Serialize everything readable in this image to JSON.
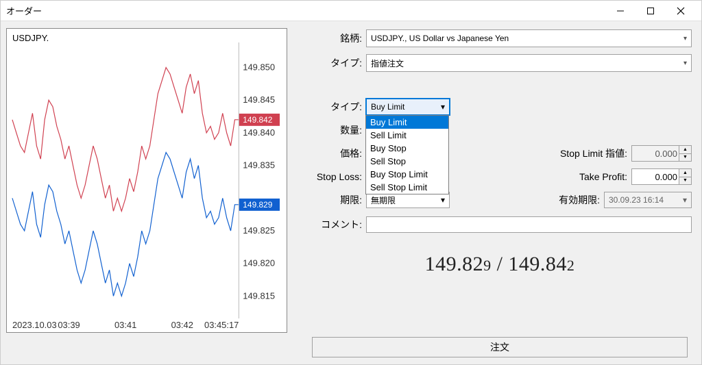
{
  "window": {
    "title": "オーダー"
  },
  "chart": {
    "symbol": "USDJPY.",
    "bid": "149.829",
    "ask": "149.842",
    "x_ticks": [
      "2023.10.03",
      "03:39",
      "03:41",
      "03:42",
      "03:45:17"
    ],
    "y_ticks": [
      "149.850",
      "149.845",
      "149.840",
      "149.835",
      "149.825",
      "149.820",
      "149.815"
    ]
  },
  "form": {
    "labels": {
      "symbol": "銘柄:",
      "type": "タイプ:",
      "order_type": "タイプ:",
      "volume": "数量:",
      "price": "価格:",
      "sl": "Stop Loss:",
      "expiry": "期限:",
      "comment": "コメント:",
      "stop_limit_price": "Stop Limit 指値:",
      "tp": "Take Profit:",
      "expiry_date": "有効期限:"
    },
    "symbol_value": "USDJPY., US Dollar vs Japanese Yen",
    "type_value": "指値注文",
    "order_type_value": "Buy Limit",
    "order_type_options": [
      "Buy Limit",
      "Sell Limit",
      "Buy Stop",
      "Sell Stop",
      "Buy Stop Limit",
      "Sell Stop Limit"
    ],
    "stop_limit_value": "0.000",
    "tp_value": "0.000",
    "expiry_value": "無期限",
    "expiry_date_value": "30.09.23 16:14",
    "order_button": "注文"
  },
  "prices": {
    "bid_main": "149.82",
    "bid_frac": "9",
    "separator": " / ",
    "ask_main": "149.84",
    "ask_frac": "2"
  },
  "chart_data": {
    "type": "line",
    "title": "USDJPY.",
    "xlabel": "",
    "ylabel": "",
    "ylim": [
      149.812,
      149.853
    ],
    "series": [
      {
        "name": "ask",
        "color": "#d04050",
        "values": [
          149.842,
          149.84,
          149.838,
          149.837,
          149.84,
          149.843,
          149.838,
          149.836,
          149.842,
          149.845,
          149.844,
          149.841,
          149.839,
          149.836,
          149.838,
          149.835,
          149.832,
          149.83,
          149.832,
          149.835,
          149.838,
          149.836,
          149.833,
          149.83,
          149.832,
          149.828,
          149.83,
          149.828,
          149.83,
          149.833,
          149.831,
          149.834,
          149.838,
          149.836,
          149.838,
          149.842,
          149.846,
          149.848,
          149.85,
          149.849,
          149.847,
          149.845,
          149.843,
          149.847,
          149.849,
          149.846,
          149.848,
          149.843,
          149.84,
          149.841,
          149.839,
          149.84,
          149.843,
          149.84,
          149.838,
          149.842,
          149.842
        ]
      },
      {
        "name": "bid",
        "color": "#1060d0",
        "values": [
          149.83,
          149.828,
          149.826,
          149.825,
          149.828,
          149.831,
          149.826,
          149.824,
          149.829,
          149.832,
          149.831,
          149.828,
          149.826,
          149.823,
          149.825,
          149.822,
          149.819,
          149.817,
          149.819,
          149.822,
          149.825,
          149.823,
          149.82,
          149.817,
          149.819,
          149.815,
          149.817,
          149.815,
          149.817,
          149.82,
          149.818,
          149.821,
          149.825,
          149.823,
          149.825,
          149.829,
          149.833,
          149.835,
          149.837,
          149.836,
          149.834,
          149.832,
          149.83,
          149.834,
          149.836,
          149.833,
          149.835,
          149.83,
          149.827,
          149.828,
          149.826,
          149.827,
          149.83,
          149.827,
          149.825,
          149.829,
          149.829
        ]
      }
    ]
  }
}
